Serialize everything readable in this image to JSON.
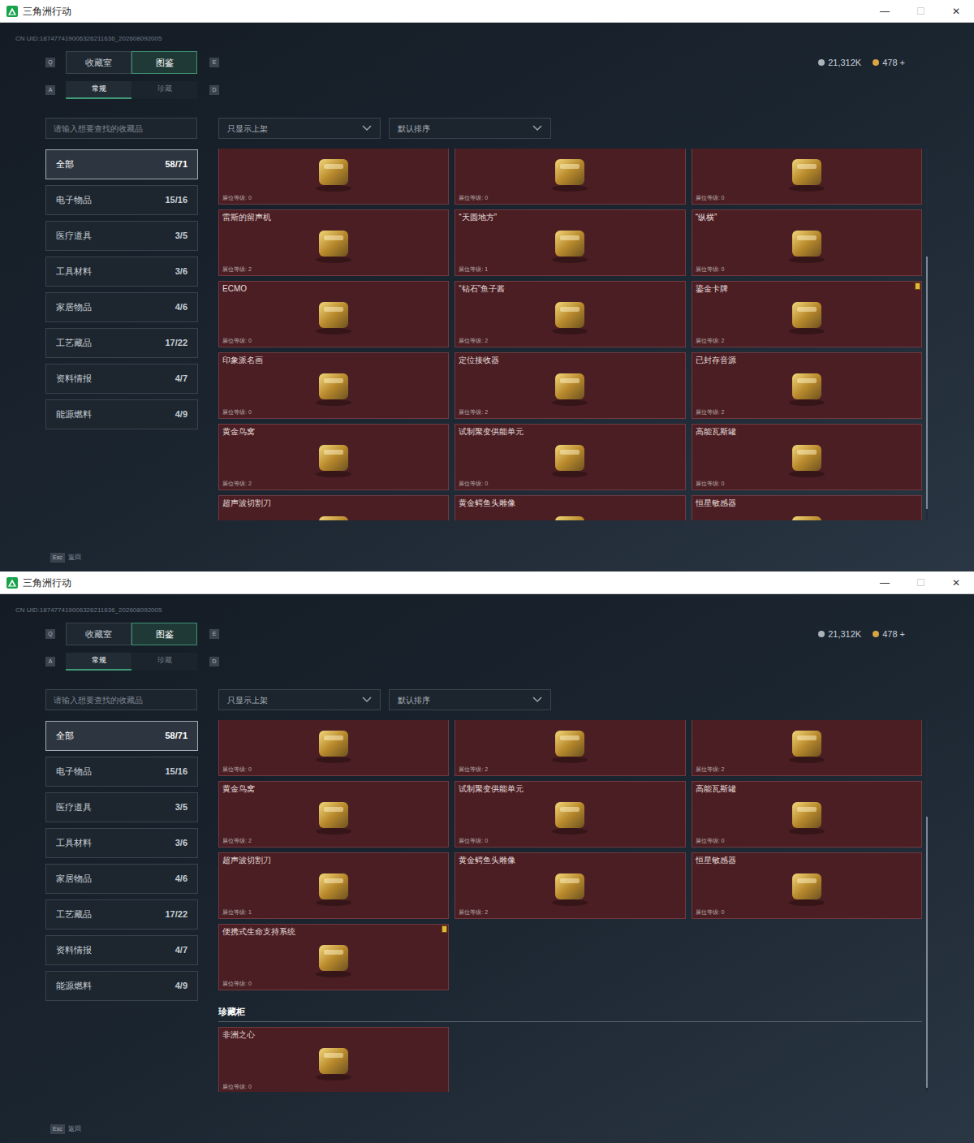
{
  "windows": [
    {
      "title": "三角洲行动",
      "controls": [
        "—",
        "☐",
        "✕"
      ],
      "uid": "CN UID:187477419006326211636_202608092005",
      "currency": [
        {
          "value": "21,312K",
          "kind": "silver"
        },
        {
          "value": "478 +",
          "kind": "gold"
        }
      ],
      "tab_keys": [
        "Q",
        "E"
      ],
      "tabs": [
        {
          "label": "收藏室",
          "selected": false
        },
        {
          "label": "图鉴",
          "selected": true
        }
      ],
      "subtab_keys": [
        "A",
        "D"
      ],
      "subtabs": [
        {
          "label": "常规",
          "selected": true
        },
        {
          "label": "珍藏",
          "selected": false
        }
      ],
      "search": {
        "placeholder": "请输入想要查找的收藏品"
      },
      "dropdowns": [
        "只显示上架",
        "默认排序"
      ],
      "sidebar": [
        {
          "label": "全部",
          "count": "58/71",
          "selected": true
        },
        {
          "label": "电子物品",
          "count": "15/16",
          "selected": false
        },
        {
          "label": "医疗道具",
          "count": "3/5",
          "selected": false
        },
        {
          "label": "工具材料",
          "count": "3/6",
          "selected": false
        },
        {
          "label": "家居物品",
          "count": "4/6",
          "selected": false
        },
        {
          "label": "工艺藏品",
          "count": "17/22",
          "selected": false
        },
        {
          "label": "资料情报",
          "count": "4/7",
          "selected": false
        },
        {
          "label": "能源燃料",
          "count": "4/9",
          "selected": false
        }
      ],
      "sections": [
        {
          "title": "",
          "items": [
            {
              "level": "展位等级: 0",
              "marked": false
            },
            {
              "level": "展位等级: 0",
              "marked": false
            },
            {
              "level": "展位等级: 0",
              "marked": false
            },
            {
              "name": "雷斯的留声机",
              "level": "展位等级: 2",
              "marked": false
            },
            {
              "name": "“天圆地方”",
              "level": "展位等级: 1",
              "marked": false
            },
            {
              "name": "“纵横”",
              "level": "展位等级: 0",
              "marked": false
            },
            {
              "name": "ECMO",
              "level": "展位等级: 0",
              "marked": false
            },
            {
              "name": "“钻石”鱼子酱",
              "level": "展位等级: 2",
              "marked": false
            },
            {
              "name": "鎏金卡牌",
              "level": "展位等级: 2",
              "marked": true
            },
            {
              "name": "印象派名画",
              "level": "展位等级: 0",
              "marked": false
            },
            {
              "name": "定位接收器",
              "level": "展位等级: 2",
              "marked": false
            },
            {
              "name": "已封存音源",
              "level": "展位等级: 2",
              "marked": false
            },
            {
              "name": "黄金鸟窝",
              "level": "展位等级: 2",
              "marked": false
            },
            {
              "name": "试制聚变供能单元",
              "level": "展位等级: 0",
              "marked": false
            },
            {
              "name": "高能瓦斯罐",
              "level": "展位等级: 0",
              "marked": false
            },
            {
              "name": "超声波切割刀",
              "marked": false
            },
            {
              "name": "黄金鳄鱼头雕像",
              "marked": false
            },
            {
              "name": "恒星敏感器",
              "marked": false
            }
          ]
        }
      ],
      "scrollbar": {
        "start": 0.29,
        "size": 0.68
      },
      "footer": {
        "key": "Esc",
        "label": "返回"
      }
    },
    {
      "title": "三角洲行动",
      "controls": [
        "—",
        "☐",
        "✕"
      ],
      "uid": "CN UID:187477419006326211636_202608092005",
      "currency": [
        {
          "value": "21,312K",
          "kind": "silver"
        },
        {
          "value": "478 +",
          "kind": "gold"
        }
      ],
      "tab_keys": [
        "Q",
        "E"
      ],
      "tabs": [
        {
          "label": "收藏室",
          "selected": false
        },
        {
          "label": "图鉴",
          "selected": true
        }
      ],
      "subtab_keys": [
        "A",
        "D"
      ],
      "subtabs": [
        {
          "label": "常规",
          "selected": true
        },
        {
          "label": "珍藏",
          "selected": false
        }
      ],
      "search": {
        "placeholder": "请输入想要查找的收藏品"
      },
      "dropdowns": [
        "只显示上架",
        "默认排序"
      ],
      "sidebar": [
        {
          "label": "全部",
          "count": "58/71",
          "selected": true
        },
        {
          "label": "电子物品",
          "count": "15/16",
          "selected": false
        },
        {
          "label": "医疗道具",
          "count": "3/5",
          "selected": false
        },
        {
          "label": "工具材料",
          "count": "3/6",
          "selected": false
        },
        {
          "label": "家居物品",
          "count": "4/6",
          "selected": false
        },
        {
          "label": "工艺藏品",
          "count": "17/22",
          "selected": false
        },
        {
          "label": "资料情报",
          "count": "4/7",
          "selected": false
        },
        {
          "label": "能源燃料",
          "count": "4/9",
          "selected": false
        }
      ],
      "sections": [
        {
          "title": "",
          "items": [
            {
              "level": "展位等级: 0",
              "marked": false
            },
            {
              "level": "展位等级: 2",
              "marked": false
            },
            {
              "level": "展位等级: 2",
              "marked": false
            },
            {
              "name": "黄金鸟窝",
              "level": "展位等级: 2",
              "marked": false
            },
            {
              "name": "试制聚变供能单元",
              "level": "展位等级: 0",
              "marked": false
            },
            {
              "name": "高能瓦斯罐",
              "level": "展位等级: 0",
              "marked": false
            },
            {
              "name": "超声波切割刀",
              "level": "展位等级: 1",
              "marked": false
            },
            {
              "name": "黄金鳄鱼头雕像",
              "level": "展位等级: 2",
              "marked": false
            },
            {
              "name": "恒星敏感器",
              "level": "展位等级: 0",
              "marked": false
            },
            {
              "name": "便携式生命支持系统",
              "level": "展位等级: 0",
              "marked": true
            }
          ]
        },
        {
          "title": "珍藏柜",
          "items": [
            {
              "name": "非洲之心",
              "level": "展位等级: 0",
              "marked": false
            }
          ]
        }
      ],
      "scrollbar": {
        "start": 0.26,
        "size": 0.73
      },
      "footer": {
        "key": "Esc",
        "label": "返回"
      }
    }
  ]
}
